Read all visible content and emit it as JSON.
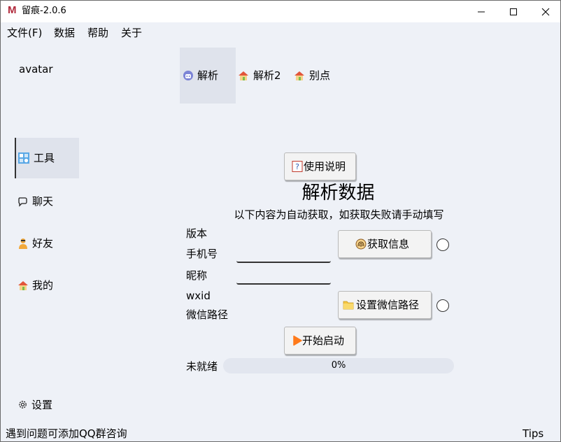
{
  "window": {
    "title": "留痕-2.0.6",
    "logo": "M"
  },
  "menu": [
    "文件(F)",
    "数据",
    "帮助",
    "关于"
  ],
  "sidebar": {
    "avatar": "avatar",
    "items": [
      {
        "label": "工具",
        "icon": "tools-icon",
        "active": true
      },
      {
        "label": "聊天",
        "icon": "chat-icon",
        "active": false
      },
      {
        "label": "好友",
        "icon": "friend-icon",
        "active": false
      },
      {
        "label": "我的",
        "icon": "home-icon",
        "active": false
      }
    ],
    "settings": "设置"
  },
  "tabs": [
    {
      "label": "解析",
      "icon": "robot-icon",
      "active": true
    },
    {
      "label": "解析2",
      "icon": "house-icon",
      "active": false
    },
    {
      "label": "别点",
      "icon": "house-icon",
      "active": false
    }
  ],
  "main": {
    "help_button": "使用说明",
    "heading": "解析数据",
    "subheading": "以下内容为自动获取，如获取失败请手动填写",
    "fields": {
      "version": "版本",
      "phone": "手机号",
      "nickname": "昵称",
      "wxid": "wxid",
      "wechat_path": "微信路径"
    },
    "get_info_button": "获取信息",
    "set_path_button": "设置微信路径",
    "start_button": "开始启动",
    "status": "未就绪",
    "progress_text": "0%",
    "progress_value": 0
  },
  "footer": {
    "left": "遇到问题可添加QQ群咨询",
    "right": "Tips"
  },
  "colors": {
    "background": "#eef1f7",
    "active_item": "#dfe3ec",
    "logo": "#b0283a",
    "start_icon": "#ff7a1a",
    "folder_icon": "#f5c542"
  }
}
